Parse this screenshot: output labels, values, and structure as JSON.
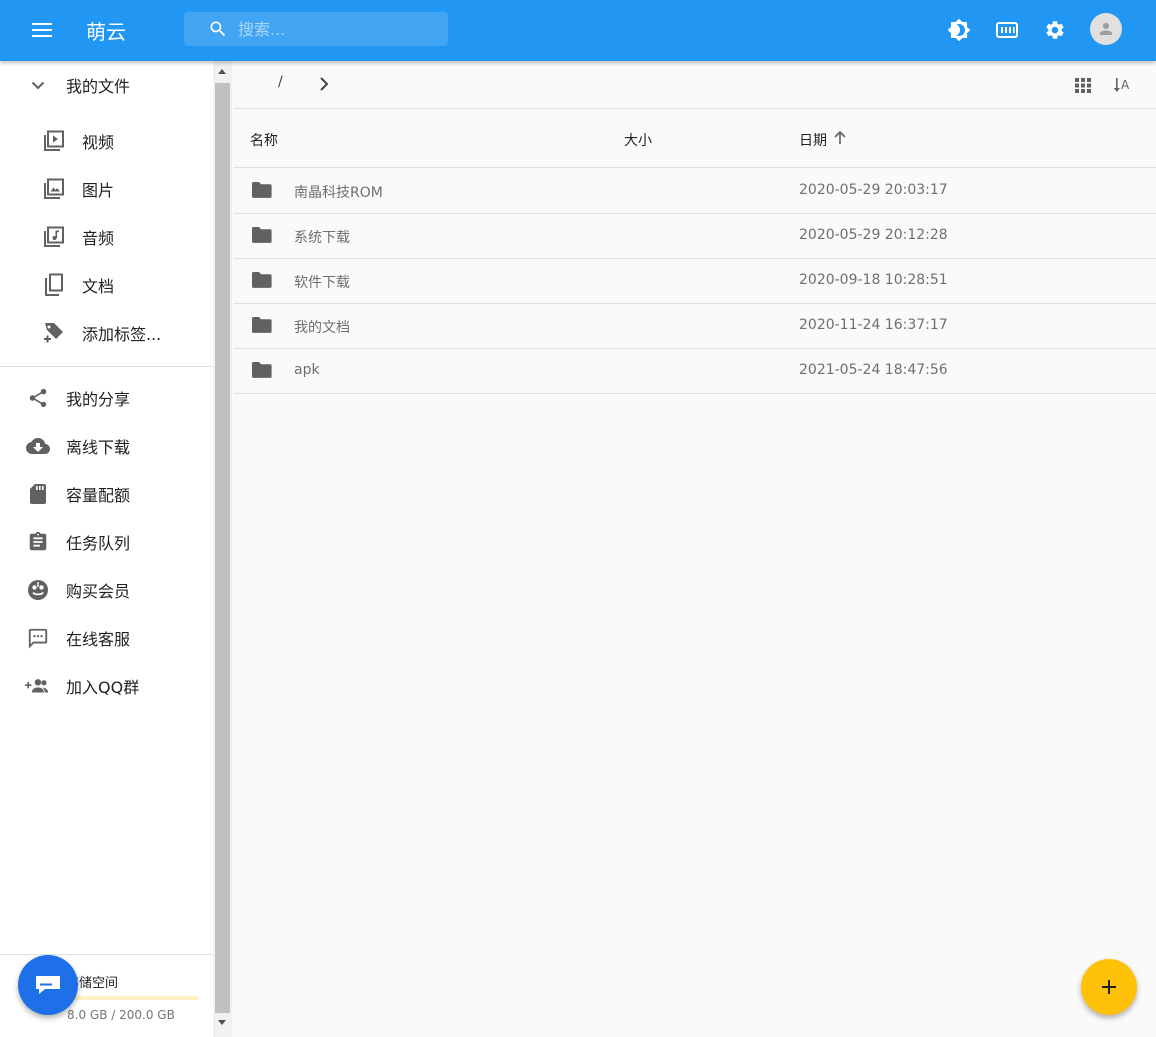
{
  "appbar": {
    "title": "萌云",
    "search_placeholder": "搜索..."
  },
  "sidebar": {
    "my_files": "我的文件",
    "sub_items": [
      {
        "label": "视频",
        "icon": "video-file-icon"
      },
      {
        "label": "图片",
        "icon": "image-file-icon"
      },
      {
        "label": "音频",
        "icon": "audio-file-icon"
      },
      {
        "label": "文档",
        "icon": "document-copy-icon"
      },
      {
        "label": "添加标签...",
        "icon": "tag-plus-icon"
      }
    ],
    "items": [
      {
        "label": "我的分享",
        "icon": "share-icon"
      },
      {
        "label": "离线下载",
        "icon": "cloud-download-icon"
      },
      {
        "label": "容量配额",
        "icon": "sd-card-icon"
      },
      {
        "label": "任务队列",
        "icon": "clipboard-list-icon"
      },
      {
        "label": "购买会员",
        "icon": "vip-icon"
      },
      {
        "label": "在线客服",
        "icon": "chat-icon"
      },
      {
        "label": "加入QQ群",
        "icon": "group-add-icon"
      }
    ],
    "storage": {
      "title": "存储空间",
      "usage": "8.0 GB / 200.0 GB",
      "fraction": 0.04
    }
  },
  "navbar": {
    "crumb_root": "/"
  },
  "table": {
    "columns": {
      "name": "名称",
      "size": "大小",
      "date": "日期"
    },
    "rows": [
      {
        "name": "南晶科技ROM",
        "size": "",
        "date": "2020-05-29 20:03:17"
      },
      {
        "name": "系统下载",
        "size": "",
        "date": "2020-05-29 20:12:28"
      },
      {
        "name": "软件下载",
        "size": "",
        "date": "2020-09-18 10:28:51"
      },
      {
        "name": "我的文档",
        "size": "",
        "date": "2020-11-24 16:37:17"
      },
      {
        "name": "apk",
        "size": "",
        "date": "2021-05-24 18:47:56"
      }
    ]
  },
  "colors": {
    "primary": "#2196f3",
    "accent": "#ffc107",
    "chat": "#1f6fe8",
    "icon_gray": "#616161"
  }
}
